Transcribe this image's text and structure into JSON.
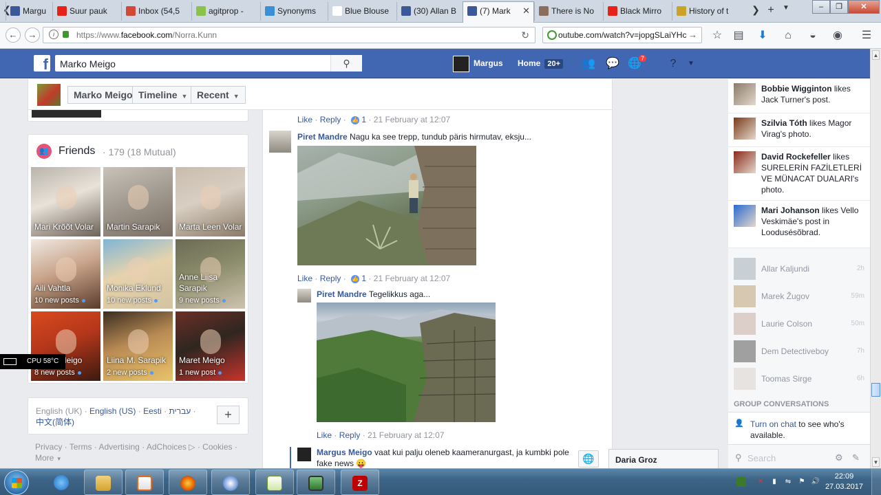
{
  "browser": {
    "tabs": [
      {
        "title": "Margu",
        "icon_color": "#3b5998"
      },
      {
        "title": "Suur pauk",
        "icon_color": "#e62117"
      },
      {
        "title": "Inbox (54,5",
        "icon_color": "#d14836"
      },
      {
        "title": "agitprop -",
        "icon_color": "#8bc34a"
      },
      {
        "title": "Synonyms",
        "icon_color": "#3a8fd9"
      },
      {
        "title": "Blue Blouse",
        "icon_color": "#ffffff"
      },
      {
        "title": "(30) Allan B",
        "icon_color": "#3b5998"
      },
      {
        "title": "(7) Mark",
        "icon_color": "#3b5998"
      },
      {
        "title": "There is No",
        "icon_color": "#8a6d5a"
      },
      {
        "title": "Black Mirro",
        "icon_color": "#e62117"
      },
      {
        "title": "History of t",
        "icon_color": "#c9a227"
      }
    ],
    "url_prefix": "https://www.",
    "url_domain": "facebook.com",
    "url_path": "/Norra.Kunn",
    "search_value": "outube.com/watch?v=jopgSLaiYHc"
  },
  "fb": {
    "search_value": "Marko Meigo",
    "profile_name": "Margus",
    "home_label": "Home",
    "home_badge": "20+",
    "notif_count": "7"
  },
  "cover": {
    "name_button": "Marko Meigo",
    "timeline_button": "Timeline",
    "recent_button": "Recent"
  },
  "friends": {
    "title": "Friends",
    "count": "· 179 (18 Mutual)",
    "tiles": [
      {
        "name": "Mari Krõõt Volar",
        "posts": "",
        "colors": [
          "#b9b4ac",
          "#6c6258",
          "#e8e2d8"
        ]
      },
      {
        "name": "Martin Sarapik",
        "posts": "",
        "colors": [
          "#c8c2b8",
          "#7a6e62",
          "#a39c92"
        ]
      },
      {
        "name": "Marta Leen Volar",
        "posts": "",
        "colors": [
          "#c9bcae",
          "#8b7a68",
          "#d8cfc2"
        ]
      },
      {
        "name": "Aili Vahtla",
        "posts": "10 new posts",
        "colors": [
          "#efe9e3",
          "#5a3b2c",
          "#c9a48a"
        ]
      },
      {
        "name": "Monika Eklund",
        "posts": "10 new posts",
        "colors": [
          "#7fb5d6",
          "#d3c3a0",
          "#e6d3ad"
        ]
      },
      {
        "name": "Anne Liisa Sarapik",
        "posts": "9 new posts",
        "colors": [
          "#6b6b55",
          "#cfc3b0",
          "#8a8c6a"
        ]
      },
      {
        "name": "Marko Meigo",
        "posts": "8 new posts",
        "colors": [
          "#d94a1f",
          "#3b1a10",
          "#b3361a"
        ]
      },
      {
        "name": "Liina M. Sarapik",
        "posts": "2 new posts",
        "colors": [
          "#3a2d20",
          "#e9c36a",
          "#b98b54"
        ]
      },
      {
        "name": "Maret Meigo",
        "posts": "1 new post",
        "colors": [
          "#6b2f27",
          "#c7342c",
          "#2f2620"
        ]
      }
    ]
  },
  "languages": {
    "current": "English (UK)",
    "links": [
      "English (US)",
      "Eesti",
      "עברית",
      "中文(简体)"
    ],
    "sep": "·"
  },
  "footer": {
    "links": [
      "Privacy",
      "Terms",
      "Advertising",
      "AdChoices",
      "Cookies",
      "More"
    ]
  },
  "cpu": {
    "text": "CPU 58°C"
  },
  "comments": {
    "like": "Like",
    "reply": "Reply",
    "sep": "·",
    "items": [
      {
        "likes": "1",
        "time": "21 February at 12:07"
      },
      {
        "author": "Piret Mandre",
        "text": "Nagu ka see trepp, tundub päris hirmutav, eksju..."
      },
      {
        "likes": "1",
        "time": "21 February at 12:07"
      },
      {
        "author": "Piret Mandre",
        "text": "Tegelikkus aga..."
      },
      {
        "likes": "",
        "time": "21 February at 12:07"
      },
      {
        "author": "Margus Meigo",
        "text": "vaat kui palju oleneb kaameranurgast, ja kumbki pole",
        "text2": "fake news 😛"
      }
    ]
  },
  "ticker": [
    {
      "name": "Bobbie Wigginton",
      "text": "likes Jack Turner's post.",
      "color": "#8a7a6a"
    },
    {
      "name": "Szilvia Tóth",
      "text": "likes Magor Virag's photo.",
      "color": "#7a3a1a"
    },
    {
      "name": "David Rockefeller",
      "text": "likes SURELERİN FAZİLETLERİ VE MÜNACAT DUALARI's photo.",
      "color": "#8a2a1a"
    },
    {
      "name": "Mari Johanson",
      "text": "likes Vello Veskimäe's post in Loodusésõbrad.",
      "color": "#2a6ad0"
    }
  ],
  "chat": {
    "contacts": [
      {
        "name": "Allar Kaljundi",
        "time": "2h",
        "color": "#9aa7b2"
      },
      {
        "name": "Marek Žugov",
        "time": "59m",
        "color": "#b59a6a"
      },
      {
        "name": "Laurie Colson",
        "time": "50m",
        "color": "#c2a89a"
      },
      {
        "name": "Dem Detectiveboy",
        "time": "7h",
        "color": "#4a4a4a"
      },
      {
        "name": "Toomas Sirge",
        "time": "6h",
        "color": "#d5cfc8"
      }
    ],
    "group_header": "GROUP CONVERSATIONS",
    "turn_on_link": "Turn on chat",
    "turn_on_rest": "to see who's available.",
    "search_placeholder": "Search",
    "tab_name": "Daria Groz"
  },
  "taskbar": {
    "time": "22:09",
    "date": "27.03.2017"
  }
}
